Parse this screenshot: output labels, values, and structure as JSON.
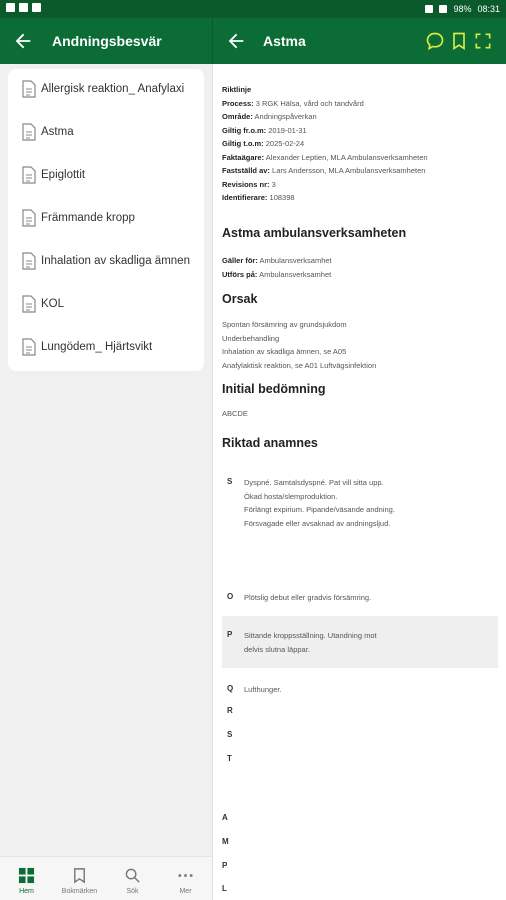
{
  "statusbar": {
    "battery": "98%",
    "time": "08:31"
  },
  "left_panel": {
    "title": "Andningsbesvär",
    "items": [
      "Allergisk reaktion_ Anafylaxi",
      "Astma",
      "Epiglottit",
      "Främmande kropp",
      "Inhalation av skadliga ämnen",
      "KOL",
      "Lungödem_ Hjärtsvikt"
    ]
  },
  "bottom_nav": [
    {
      "label": "Hem",
      "icon": "grid-icon"
    },
    {
      "label": "Bokmärken",
      "icon": "bookmark-icon"
    },
    {
      "label": "Sök",
      "icon": "search-icon"
    },
    {
      "label": "Mer",
      "icon": "more-icon"
    }
  ],
  "doc": {
    "title": "Astma",
    "actions": [
      "comment-icon",
      "bookmark-icon",
      "fullscreen-icon"
    ],
    "meta": {
      "heading": "Riktlinje",
      "rows": [
        {
          "label": "Process:",
          "value": "3 RGK Hälsa, vård och tandvård"
        },
        {
          "label": "Område:",
          "value": "Andningspåverkan"
        },
        {
          "label": "Giltig fr.o.m:",
          "value": "2019-01-31"
        },
        {
          "label": "Giltig t.o.m:",
          "value": "2025-02-24"
        },
        {
          "label": "Faktaägare:",
          "value": "Alexander Leptien, MLA Ambulansverksamheten"
        },
        {
          "label": "Fastställd av:",
          "value": "Lars Andersson, MLA Ambulansverksamheten"
        },
        {
          "label": "Revisions nr:",
          "value": "3"
        },
        {
          "label": "Identifierare:",
          "value": "108398"
        }
      ]
    },
    "section1": {
      "heading": "Astma ambulansverksamheten",
      "rows": [
        {
          "label": "Gäller för:",
          "value": "Ambulansverksamhet"
        },
        {
          "label": "Utförs på:",
          "value": "Ambulansverksamhet"
        }
      ]
    },
    "orsak": {
      "heading": "Orsak",
      "lines": [
        "Spontan försämring av grundsjukdom",
        "Underbehandling",
        "Inhalation av skadliga ämnen, se A05",
        "Anafylaktisk reaktion, se A01 Luftvägsinfektion"
      ]
    },
    "initial": {
      "heading": "Initial bedömning",
      "text": "ABCDE"
    },
    "anamnes": {
      "heading": "Riktad anamnes",
      "S": {
        "letter": "S",
        "lines": [
          "Dyspné. Samtalsdyspné. Pat vill sitta upp.",
          "Ökad hosta/slemproduktion.",
          "Förlängt expirium. Pipande/väsande andning.",
          "Försvagade eller avsaknad av andningsljud."
        ]
      },
      "O": {
        "letter": "O",
        "text": "Plötslig debut eller gradvis försämring."
      },
      "P": {
        "letter": "P",
        "lines": [
          "Sittande kroppsställning. Utandning mot",
          "delvis slutna läppar."
        ]
      },
      "Q": {
        "letter": "Q",
        "text": "Lufthunger."
      },
      "letters": [
        "R",
        "S",
        "T",
        "A",
        "M",
        "P",
        "L"
      ]
    }
  }
}
